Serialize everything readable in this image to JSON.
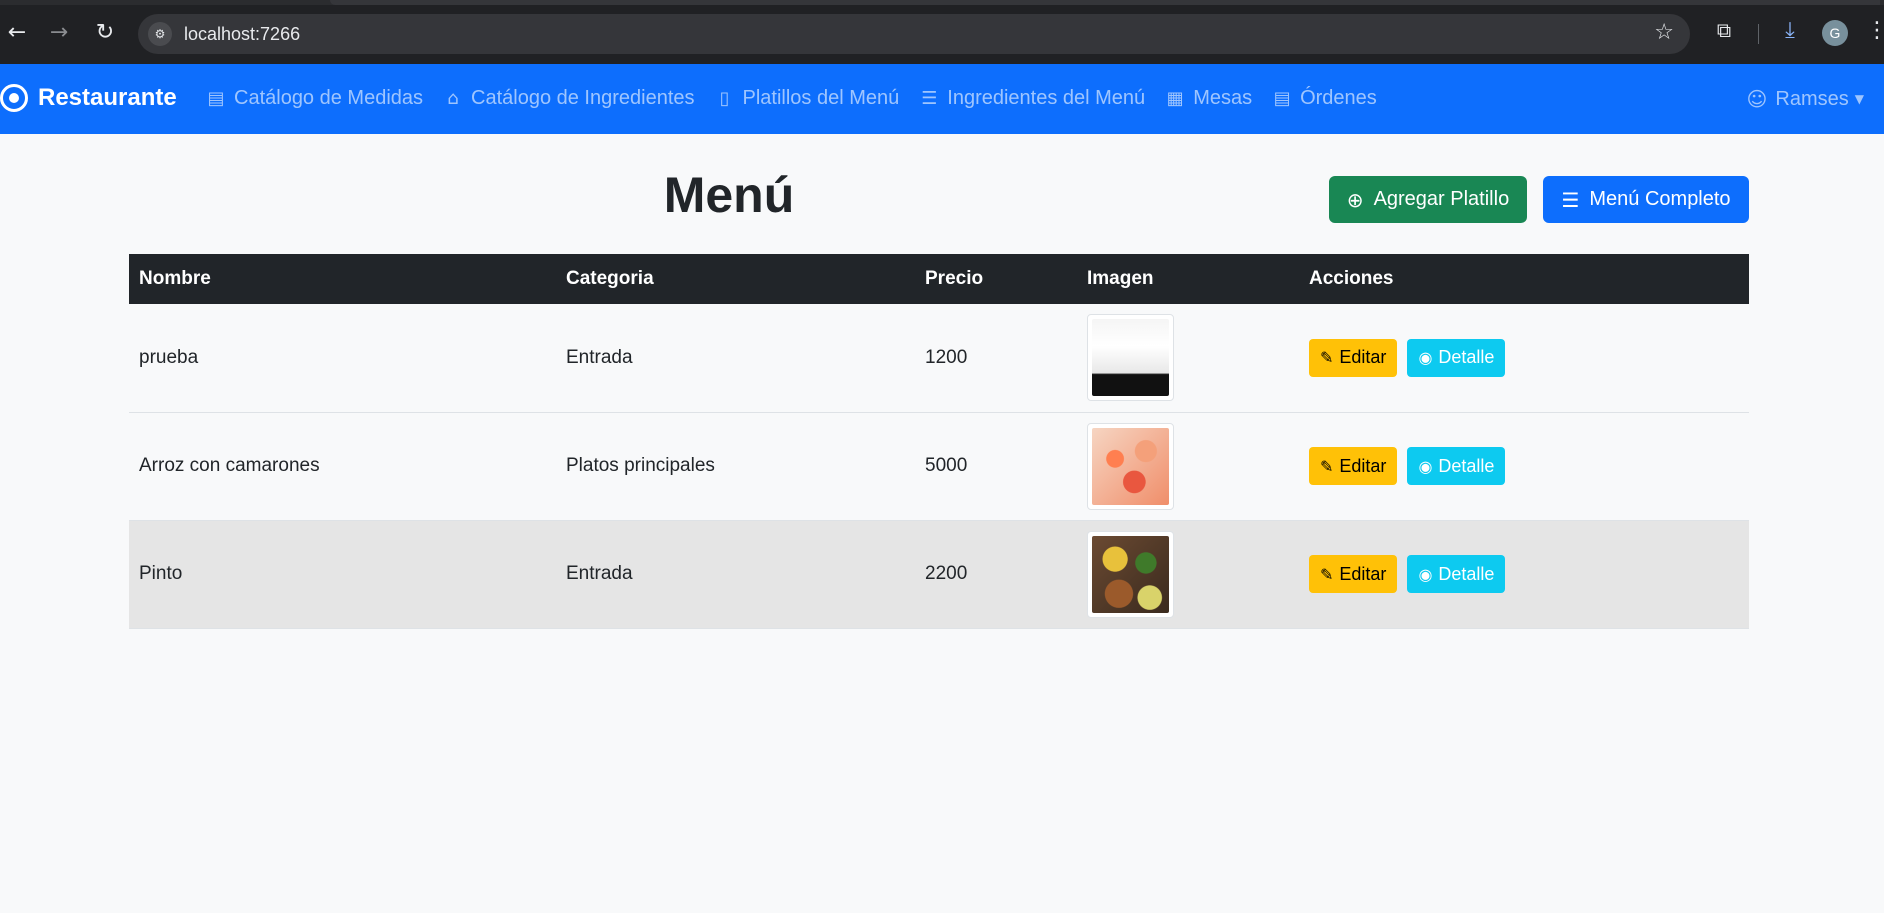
{
  "browser": {
    "url": "localhost:7266",
    "profile_initial": "G"
  },
  "navbar": {
    "brand": "Restaurante",
    "links": [
      {
        "label": "Catálogo de Medidas",
        "icon": "ruler-icon"
      },
      {
        "label": "Catálogo de Ingredientes",
        "icon": "basket-icon"
      },
      {
        "label": "Platillos del Menú",
        "icon": "journal-icon"
      },
      {
        "label": "Ingredientes del Menú",
        "icon": "list-icon"
      },
      {
        "label": "Mesas",
        "icon": "table-icon"
      },
      {
        "label": "Órdenes",
        "icon": "receipt-icon"
      }
    ],
    "user": "Ramses"
  },
  "page": {
    "title": "Menú",
    "add_button": "Agregar Platillo",
    "menu_button": "Menú Completo"
  },
  "table": {
    "headers": [
      "Nombre",
      "Categoria",
      "Precio",
      "Imagen",
      "Acciones"
    ],
    "rows": [
      {
        "nombre": "prueba",
        "categoria": "Entrada",
        "precio": "1200",
        "image": "rice-photo"
      },
      {
        "nombre": "Arroz con camarones",
        "categoria": "Platos principales",
        "precio": "5000",
        "image": "shrimp-rice-photo"
      },
      {
        "nombre": "Pinto",
        "categoria": "Entrada",
        "precio": "2200",
        "image": "pinto-plate-photo"
      }
    ],
    "edit_label": "Editar",
    "detail_label": "Detalle"
  },
  "colors": {
    "navbar": "#0d6efd",
    "add_button": "#198754",
    "menu_button": "#0d6efd",
    "edit_button": "#ffc107",
    "detail_button": "#0dcaf0",
    "table_header": "#212529"
  }
}
